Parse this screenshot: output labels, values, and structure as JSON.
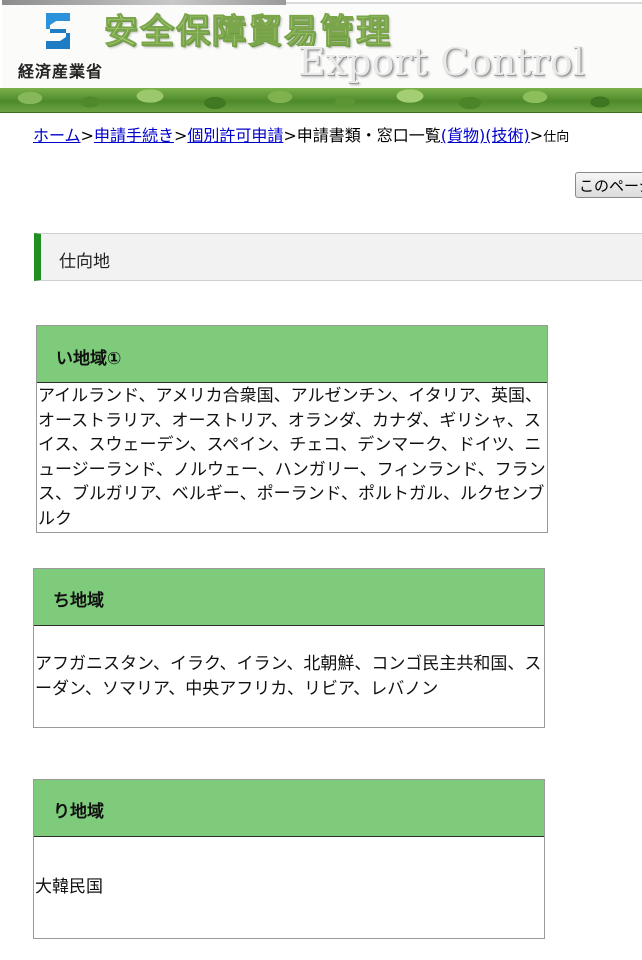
{
  "header": {
    "ministry": "経済産業省",
    "title": "安全保障貿易管理",
    "subtitle": "Export Control",
    "logo_icon": "meti-logo-icon"
  },
  "breadcrumb": {
    "home": "ホーム",
    "procedures": "申請手続き",
    "individual_permit": "個別許可申請",
    "documents_list": "申請書類・窓口一覧",
    "goods": "(貨物)",
    "technology": "(技術)",
    "current": "仕向",
    "separator": ">"
  },
  "print_button": {
    "label": "このページを印刷"
  },
  "section": {
    "title": "仕向地"
  },
  "regions": [
    {
      "name": "い地域①",
      "countries": "アイルランド、アメリカ合衆国、アルゼンチン、イタリア、英国、オーストラリア、オーストリア、オランダ、カナダ、ギリシャ、スイス、スウェーデン、スペイン、チェコ、デンマーク、ドイツ、ニュージーランド、ノルウェー、ハンガリー、フィンランド、フランス、ブルガリア、ベルギー、ポーランド、ポルトガル、ルクセンブルク"
    },
    {
      "name": "ち地域",
      "countries": "アフガニスタン、イラク、イラン、北朝鮮、コンゴ民主共和国、スーダン、ソマリア、中央アフリカ、リビア、レバノン"
    },
    {
      "name": "り地域",
      "countries": "大韓民国"
    }
  ],
  "colors": {
    "link": "#0000cc",
    "accent_green": "#1f8f1f",
    "region_header": "#7dcb7b"
  }
}
